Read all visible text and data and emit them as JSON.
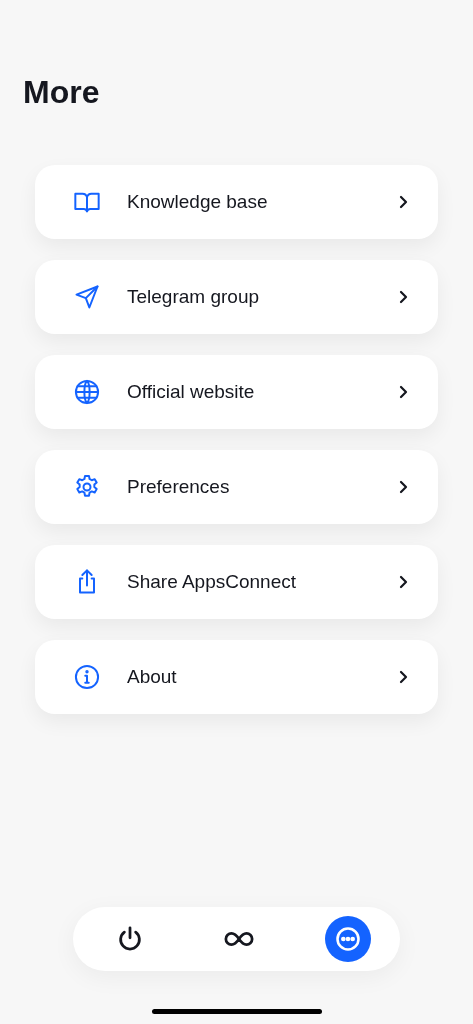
{
  "title": "More",
  "menu": [
    {
      "kind": "book",
      "label": "Knowledge base"
    },
    {
      "kind": "send",
      "label": "Telegram group"
    },
    {
      "kind": "globe",
      "label": "Official website"
    },
    {
      "kind": "gear",
      "label": "Preferences"
    },
    {
      "kind": "share",
      "label": "Share AppsConnect"
    },
    {
      "kind": "info",
      "label": "About"
    }
  ],
  "tab_bar": [
    {
      "kind": "power",
      "selected": false
    },
    {
      "kind": "infinity",
      "selected": false
    },
    {
      "kind": "more",
      "selected": true
    }
  ]
}
